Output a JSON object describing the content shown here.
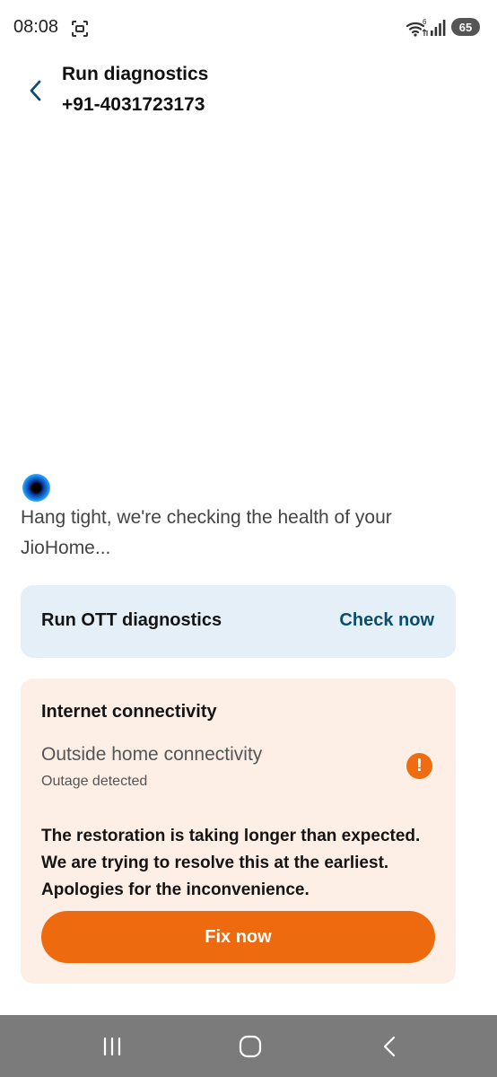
{
  "status_bar": {
    "time": "08:08",
    "battery": "65",
    "icons": [
      "screenshot-icon",
      "wifi-icon",
      "signal-icon",
      "battery-icon"
    ]
  },
  "header": {
    "title": "Run diagnostics",
    "subtitle": "+91-4031723173",
    "back_icon": "chevron-left-icon"
  },
  "loading": {
    "text": "Hang tight, we're checking the health of your JioHome..."
  },
  "ott_card": {
    "title": "Run OTT diagnostics",
    "action": "Check now"
  },
  "internet_card": {
    "title": "Internet connectivity",
    "row_title": "Outside home connectivity",
    "row_status": "Outage detected",
    "alert_icon": "exclamation-icon",
    "alert_glyph": "!",
    "message": "The restoration is taking longer than expected. We are trying to resolve this at the earliest. Apologies for the inconvenience.",
    "button": "Fix now"
  },
  "nav_bar": {
    "icons": [
      "recents-icon",
      "home-icon",
      "back-icon"
    ]
  },
  "colors": {
    "accent_orange": "#ee6a0f",
    "action_blue": "#0a4d6e",
    "ott_card_bg": "#e4eff7",
    "alert_card_bg": "#fdeee6",
    "nav_bar_bg": "#7b7b7b"
  }
}
